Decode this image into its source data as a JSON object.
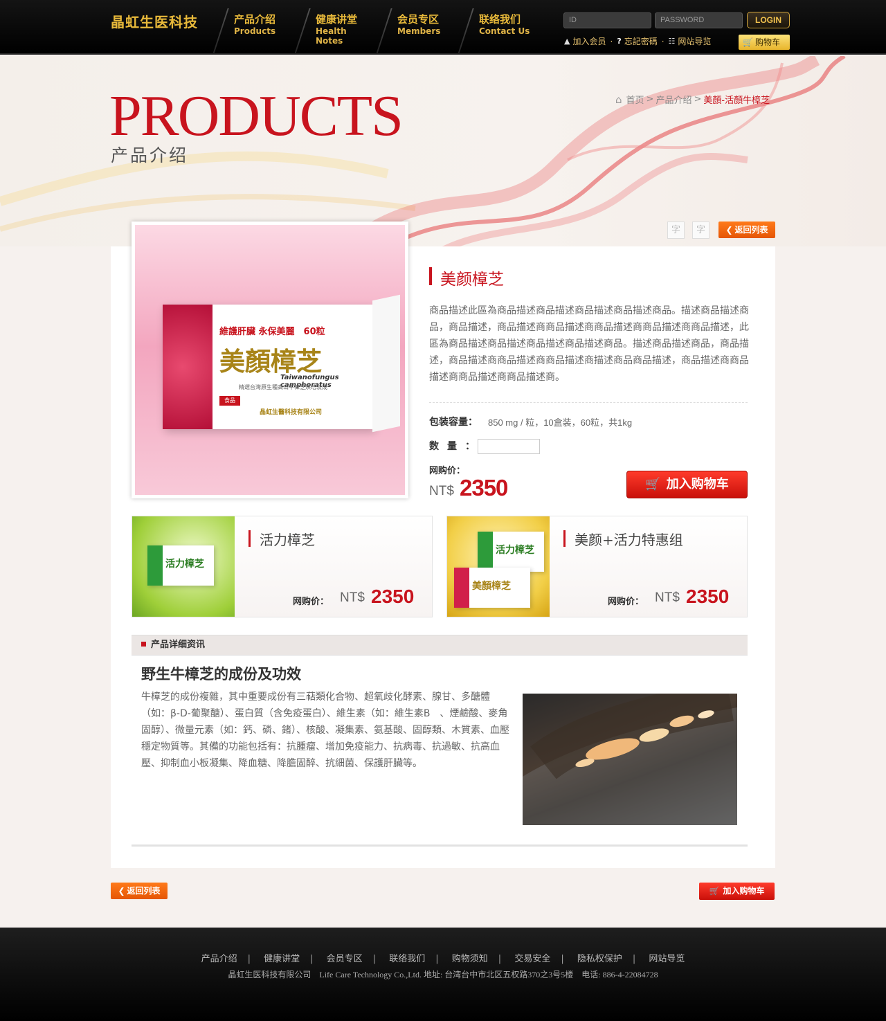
{
  "header": {
    "logo": "晶虹生医科技",
    "nav": [
      {
        "zh": "产品介绍",
        "en": "Products"
      },
      {
        "zh": "健康讲堂",
        "en": "Health Notes"
      },
      {
        "zh": "会员专区",
        "en": "Members"
      },
      {
        "zh": "联络我们",
        "en": "Contact Us"
      }
    ],
    "login": {
      "id_placeholder": "ID",
      "pw_placeholder": "PASSWORD",
      "button": "LOGIN"
    },
    "links": {
      "join": "加入会员",
      "forgot": "忘記密碼",
      "sitemap": "网站导览",
      "cart": "购物车"
    }
  },
  "banner": {
    "title": "PRODUCTS",
    "subtitle": "产品介绍",
    "breadcrumb": {
      "home": "首页",
      "category": "产品介绍",
      "current": "美顏-活顏牛樟芝"
    }
  },
  "toolbar": {
    "font_small": "字",
    "font_large": "字",
    "back": "返回列表"
  },
  "product": {
    "name": "美颜樟芝",
    "box": {
      "band": "維護肝臟 永保美麗",
      "count": "60粒",
      "name": "美顏樟芝",
      "latin": "Taiwanofungus camphoratus",
      "desc": "精選台灣原生種高山牛樟芝烘培製成",
      "company": "晶虹生醫科技有限公司",
      "food": "食品"
    },
    "description": "商品描述此區為商品描述商品描述商品描述商品描述商品。描述商品描述商品，商品描述，商品描述商商品描述商商品描述商商品描述商商品描述，此區為商品描述商品描述商品描述商品描述商品。描述商品描述商品，商品描述，商品描述商商品描述商商品描述商描述商品商品描述，商品描述商商品描述商商品描述商商品描述商。",
    "spec_label": "包装容量：",
    "spec_value": "850 mg / 粒，10盒装，60粒，共1kg",
    "qty_label": "数量：",
    "qty_value": "",
    "price_label": "网购价：",
    "currency": "NT$",
    "price": "2350",
    "add_cart": "加入购物车"
  },
  "related": [
    {
      "name": "活力樟芝",
      "price_label": "网购价：",
      "currency": "NT$",
      "price": "2350",
      "box_text": "活力樟芝"
    },
    {
      "name": "美颜+活力特惠组",
      "price_label": "网购价：",
      "currency": "NT$",
      "price": "2350",
      "box_text_1": "活力樟芝",
      "box_text_2": "美顏樟芝"
    }
  ],
  "detail": {
    "section_title": "产品详细资讯",
    "heading": "野生牛樟芝的成份及功效",
    "text": "牛樟芝的成份複雜，其中重要成份有三萜類化合物、超氧歧化酵素、腺甘、多醣體（如：β-D-葡聚醣）、蛋白質（含免疫蛋白）、維生素（如：維生素B　、煙鹼酸、麥角固醇）、微量元素（如：鈣、磷、鍺）、核酸、凝集素、氨基酸、固醇類、木質素、血壓穩定物質等。其備的功能包括有：抗腫瘤、增加免疫能力、抗病毒、抗過敏、抗高血壓、抑制血小板凝集、降血糖、降膽固醉、抗細菌、保護肝臟等。"
  },
  "bottom": {
    "back": "返回列表",
    "add_cart": "加入购物车"
  },
  "footer": {
    "links": [
      "产品介绍",
      "健康讲堂",
      "会员专区",
      "联络我们",
      "购物须知",
      "交易安全",
      "隐私权保护",
      "网站导览"
    ],
    "info": "晶虹生医科技有限公司　Life Care Technology Co.,Ltd. 地址: 台湾台中市北区五权路370之3号5楼　电话: 886-4-22084728"
  },
  "colors": {
    "accent": "#c8141e",
    "gold": "#e8b93a",
    "orange": "#ff7a1a"
  }
}
